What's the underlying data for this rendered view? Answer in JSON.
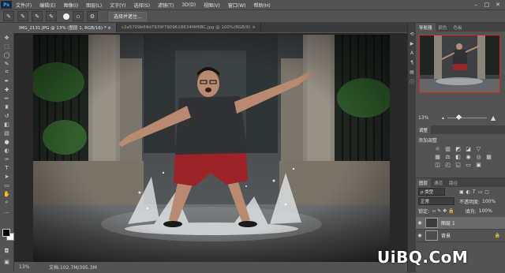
{
  "app": {
    "logo": "Ps"
  },
  "menu": [
    "文件(F)",
    "编辑(E)",
    "图像(I)",
    "图层(L)",
    "文字(Y)",
    "选择(S)",
    "滤镜(T)",
    "3D(D)",
    "视图(V)",
    "窗口(W)",
    "帮助(H)"
  ],
  "window_controls": [
    "–",
    "□",
    "✕"
  ],
  "options": {
    "subject_button": "选择并遮住..."
  },
  "doc_tabs": [
    {
      "label": "IMG_2131.JPG @ 13% (图层 1, RGB/16) * ×",
      "active": true
    },
    {
      "label": "c2a5709b69d7939f7909618834f4f6BC.jpg @ 100%(RGB/8) ×",
      "active": false
    }
  ],
  "status": {
    "zoom": "13%",
    "doc_info": "文档:102.7M/395.3M"
  },
  "navigator": {
    "tabs": [
      "导航器",
      "颜色",
      "色板"
    ],
    "zoom_value": "13%"
  },
  "adjustments": {
    "tabs": [
      "调整"
    ],
    "add_label": "添加调整"
  },
  "layers": {
    "tabs": [
      "图层",
      "通道",
      "路径"
    ],
    "kind_filter": "ρ 类型",
    "blend_mode": "正常",
    "opacity_label": "不透明度:",
    "opacity_value": "100%",
    "lock_label": "锁定:",
    "fill_label": "填充:",
    "fill_value": "100%",
    "items": [
      {
        "name": "图层 1",
        "selected": true
      },
      {
        "name": "背景",
        "selected": false
      }
    ]
  },
  "watermark": "UiBQ.CoM",
  "colors": {
    "panel": "#535353",
    "canvas_bg": "#282828",
    "accent_red": "#dd2222"
  }
}
